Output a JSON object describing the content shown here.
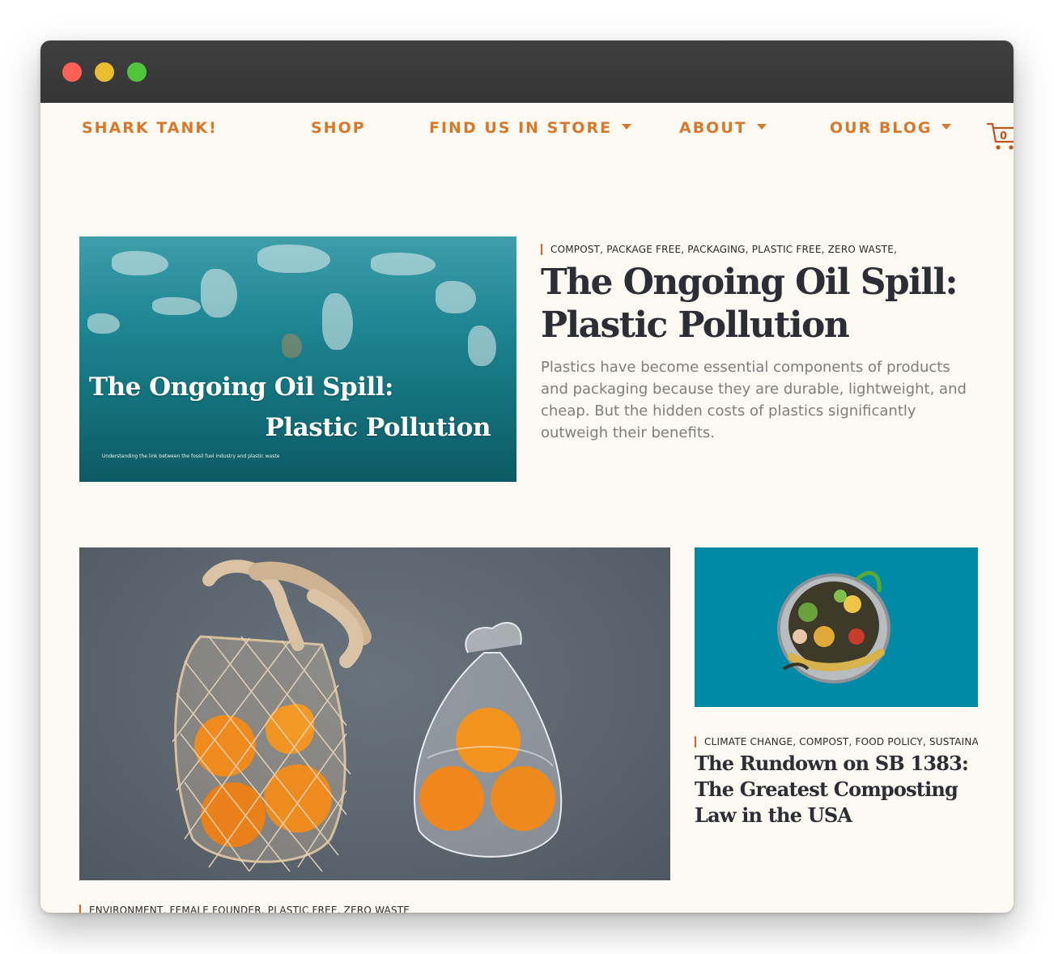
{
  "nav": {
    "items": [
      {
        "label": "SHARK TANK!",
        "has_dropdown": false
      },
      {
        "label": "SHOP",
        "has_dropdown": false
      },
      {
        "label": "FIND US IN STORE",
        "has_dropdown": true
      },
      {
        "label": "ABOUT",
        "has_dropdown": true
      },
      {
        "label": "OUR BLOG",
        "has_dropdown": true
      }
    ],
    "cart_count": "0"
  },
  "featured_post": {
    "categories": "COMPOST, PACKAGE FREE, PACKAGING, PLASTIC FREE, ZERO WASTE,",
    "title": "The Ongoing Oil Spill: Plastic Pollution",
    "excerpt": "Plastics have become essential components of products and packaging because they are durable, lightweight, and cheap. But the hidden costs of plastics significantly outweigh their benefits.",
    "image": {
      "title_line1": "The Ongoing Oil Spill:",
      "title_line2": "Plastic Pollution",
      "subtitle": "Understanding the link between the fossil fuel industry and plastic waste"
    }
  },
  "second_post": {
    "categories": "CLIMATE CHANGE, COMPOST, FOOD POLICY, SUSTAINABILITY",
    "title": "The Rundown on SB 1383: The Greatest Composting Law in the USA"
  },
  "third_post": {
    "categories": "ENVIRONMENT, FEMALE FOUNDER, PLASTIC FREE, ZERO WASTE"
  },
  "colors": {
    "accent": "#d9782a",
    "heading": "#2b2e35",
    "background": "#fcf9f3",
    "titlebar": "#3a3a3a"
  }
}
